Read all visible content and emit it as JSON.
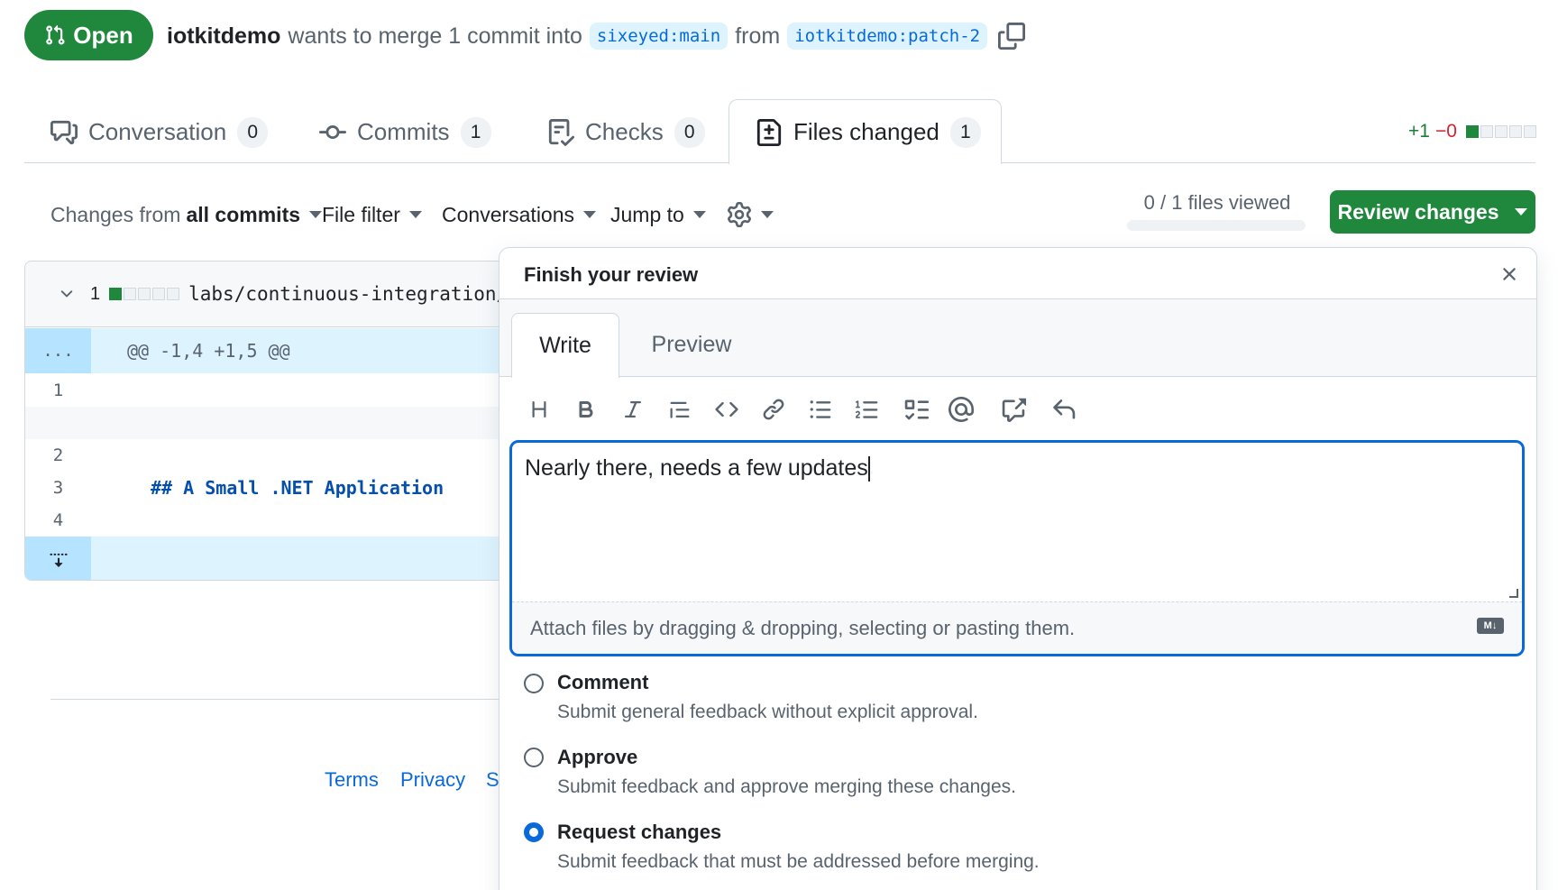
{
  "header": {
    "state": "Open",
    "author": "iotkitdemo",
    "merge_text": "wants to merge 1 commit into",
    "base_branch": "sixeyed:main",
    "from_text": "from",
    "head_branch": "iotkitdemo:patch-2"
  },
  "tabs": [
    {
      "label": "Conversation",
      "count": "0"
    },
    {
      "label": "Commits",
      "count": "1"
    },
    {
      "label": "Checks",
      "count": "0"
    },
    {
      "label": "Files changed",
      "count": "1"
    }
  ],
  "diffstat": {
    "additions": "+1",
    "deletions": "−0"
  },
  "toolbar": {
    "changes_from": "Changes from",
    "all_commits": "all commits",
    "file_filter": "File filter",
    "conversations": "Conversations",
    "jump_to": "Jump to",
    "files_viewed": "0 / 1 files viewed",
    "review_changes": "Review changes"
  },
  "diff": {
    "file_count": "1",
    "file_path": "labs/continuous-integration/",
    "hunk_gutter": "...",
    "hunk_header": "@@ -1,4 +1,5 @@",
    "lines": [
      {
        "num": "1",
        "code": ""
      },
      {
        "num": "2",
        "code": ""
      },
      {
        "num": "3",
        "code": "## A Small .NET Application"
      },
      {
        "num": "4",
        "code": ""
      }
    ]
  },
  "footer": {
    "terms": "Terms",
    "privacy": "Privacy",
    "truncated": "S"
  },
  "review": {
    "title": "Finish your review",
    "tab_write": "Write",
    "tab_preview": "Preview",
    "comment_text": "Nearly there, needs a few updates",
    "attach_text": "Attach files by dragging & dropping, selecting or pasting them.",
    "md_badge": "M↓",
    "options": [
      {
        "label": "Comment",
        "desc": "Submit general feedback without explicit approval.",
        "checked": false
      },
      {
        "label": "Approve",
        "desc": "Submit feedback and approve merging these changes.",
        "checked": false
      },
      {
        "label": "Request changes",
        "desc": "Submit feedback that must be addressed before merging.",
        "checked": true
      }
    ]
  },
  "colors": {
    "green": "#1f883d",
    "blue": "#0969da",
    "link_bg": "#ddf4ff"
  }
}
